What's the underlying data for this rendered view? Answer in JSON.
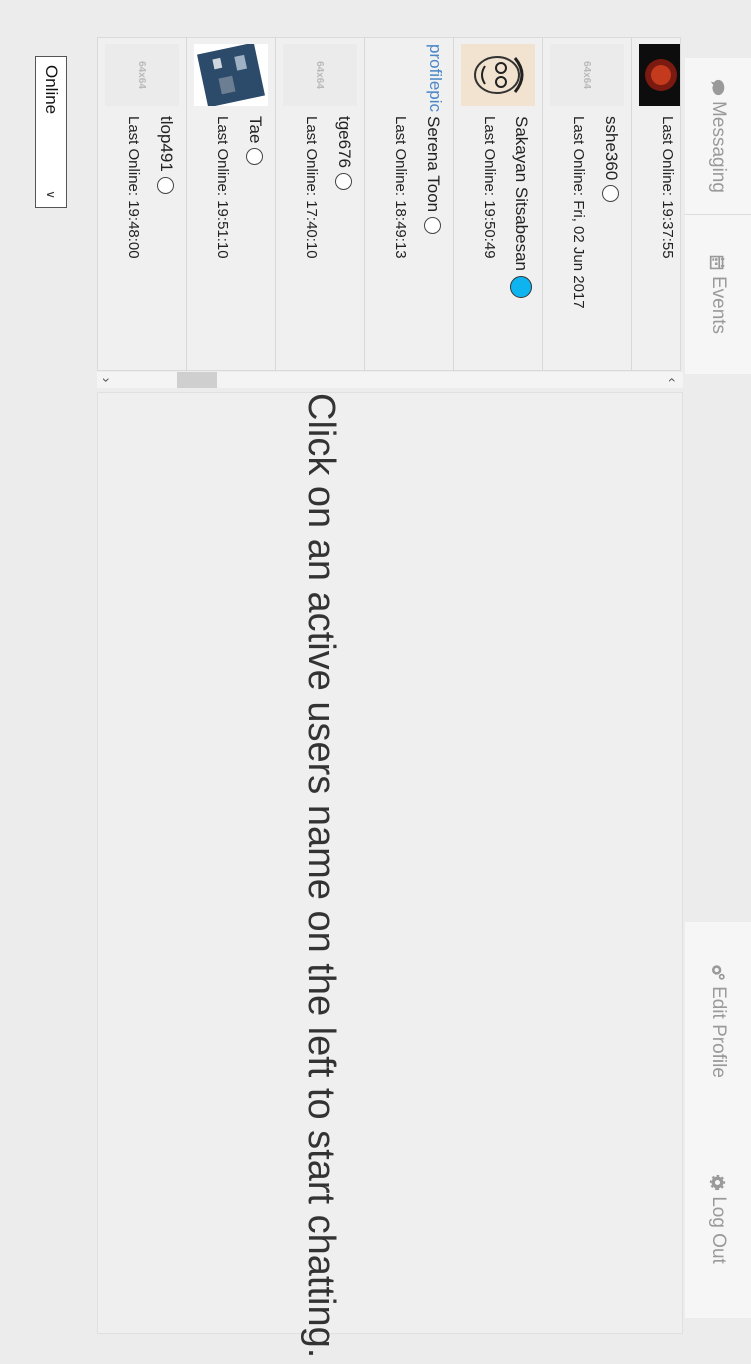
{
  "nav": {
    "messaging": "Messaging",
    "events": "Events",
    "edit_profile": "Edit Profile",
    "log_out": "Log Out"
  },
  "users": [
    {
      "name": "",
      "last": "Last Online: 19:37:55",
      "avatar": "photo-dark",
      "status": "none"
    },
    {
      "name": "sshe360",
      "last": "Last Online: Fri, 02 Jun 2017",
      "avatar": "64x64",
      "status": "offline"
    },
    {
      "name": "Sakayan Sitsabesan",
      "last": "Last Online: 19:50:49",
      "avatar": "sketch-face",
      "status": "online"
    },
    {
      "name": "Serena Toon",
      "last": "Last Online: 18:49:13",
      "avatar": "profilepic",
      "status": "offline"
    },
    {
      "name": "tge676",
      "last": "Last Online: 17:40:10",
      "avatar": "64x64",
      "status": "offline"
    },
    {
      "name": "Tae",
      "last": "Last Online: 19:51:10",
      "avatar": "circuit-board",
      "status": "offline"
    },
    {
      "name": "tlop491",
      "last": "Last Online: 19:48:00",
      "avatar": "64x64",
      "status": "offline"
    }
  ],
  "avatar_placeholder": "64x64",
  "profile_link_text": "profilepic",
  "chat": {
    "prompt": "Click on an active users name on the left to start chatting."
  },
  "status_select": {
    "value": "Online"
  },
  "colors": {
    "online": "#0db4f0",
    "link": "#4a86c8"
  }
}
